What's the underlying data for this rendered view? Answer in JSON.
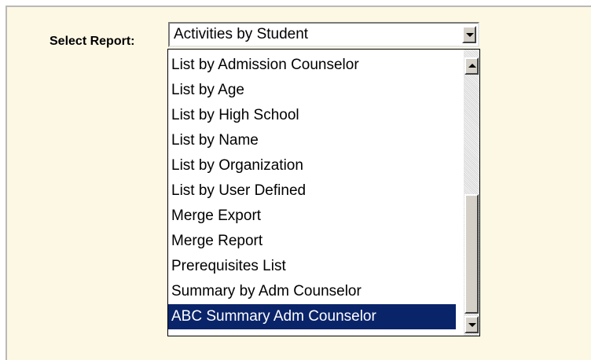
{
  "form": {
    "label": "Select Report:",
    "selected_value": "Activities by Student"
  },
  "dropdown": {
    "items": [
      "List by Admission Counselor",
      "List by Age",
      "List by High School",
      "List by Name",
      "List by Organization",
      "List by User Defined",
      "Merge Export",
      "Merge Report",
      "Prerequisites List",
      "Summary by Adm Counselor",
      "ABC Summary Adm Counselor"
    ],
    "highlighted_item": "ABC Summary Adm Counselor",
    "scroll_up_icon": "triangle-up-icon",
    "scroll_down_icon": "triangle-down-icon"
  },
  "colors": {
    "panel_background": "#fdf8e4",
    "highlight": "#0a246a"
  }
}
